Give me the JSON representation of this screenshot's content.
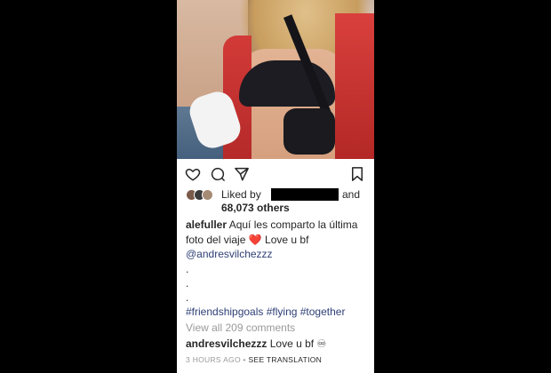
{
  "post": {
    "likes": {
      "prefix": "Liked by",
      "suffix": "and",
      "count": "68,073 others"
    },
    "caption": {
      "username": "alefuller",
      "text_line1": "Aquí les comparto la última",
      "text_line2_before": "foto del viaje",
      "heart": "❤️",
      "text_line2_after": "Love u bf",
      "mention": "@andresvilchezzz",
      "dots": [
        ".",
        ".",
        "."
      ],
      "hashtags": "#friendshipgoals #flying #together"
    },
    "view_all_comments": "View all 209 comments",
    "comment": {
      "username": "andresvilchezzz",
      "text": "Love u bf",
      "emoji": "♾"
    },
    "timestamp": "3 HOURS AGO",
    "separator": "•",
    "see_translation": "SEE TRANSLATION"
  },
  "icons": {
    "like": "heart-icon",
    "comment": "comment-icon",
    "share": "send-icon",
    "save": "bookmark-icon"
  },
  "colors": {
    "link": "#2e3f75",
    "muted": "#9a9a9a",
    "text": "#262626",
    "heart": "#e0242b"
  }
}
